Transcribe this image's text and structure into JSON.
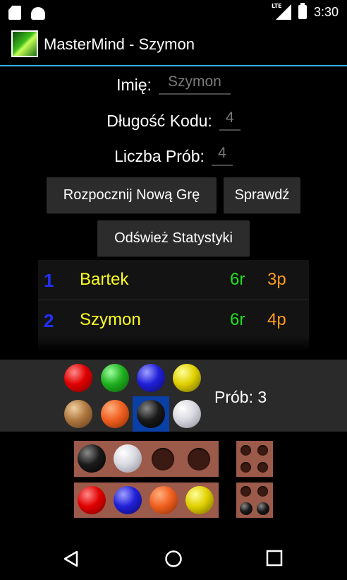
{
  "status_bar": {
    "network": "LTE",
    "time": "3:30"
  },
  "app": {
    "title": "MasterMind - Szymon"
  },
  "form": {
    "name_label": "Imię:",
    "name_value": "Szymon",
    "code_length_label": "Długość Kodu:",
    "code_length_value": "4",
    "tries_label": "Liczba Prób:",
    "tries_value": "4"
  },
  "buttons": {
    "new_game": "Rozpocznij Nową Grę",
    "check": "Sprawdź",
    "refresh_stats": "Odśwież Statystyki"
  },
  "stats": [
    {
      "rank": "1",
      "name": "Bartek",
      "rounds": "6r",
      "points": "3p"
    },
    {
      "rank": "2",
      "name": "Szymon",
      "rounds": "6r",
      "points": "4p"
    }
  ],
  "palette": {
    "colors": [
      "red",
      "green",
      "blue",
      "yellow",
      "tan",
      "orange",
      "black",
      "white"
    ],
    "selected": "black",
    "tries_text": "Prób: 3"
  },
  "board": {
    "rows": [
      {
        "pegs": [
          "black",
          "white",
          "empty",
          "empty"
        ],
        "feedback": [
          "empty",
          "empty",
          "empty",
          "empty"
        ]
      },
      {
        "pegs": [
          "red",
          "blue",
          "orange",
          "yellow"
        ],
        "feedback": [
          "empty",
          "empty",
          "black",
          "black"
        ]
      }
    ]
  },
  "colors": {
    "accent": "#33b5e5",
    "rank": "#2230ff",
    "name": "#ffff20",
    "rounds": "#20e020",
    "points": "#ff9a1a",
    "selected_bg": "#0a3fa6"
  }
}
